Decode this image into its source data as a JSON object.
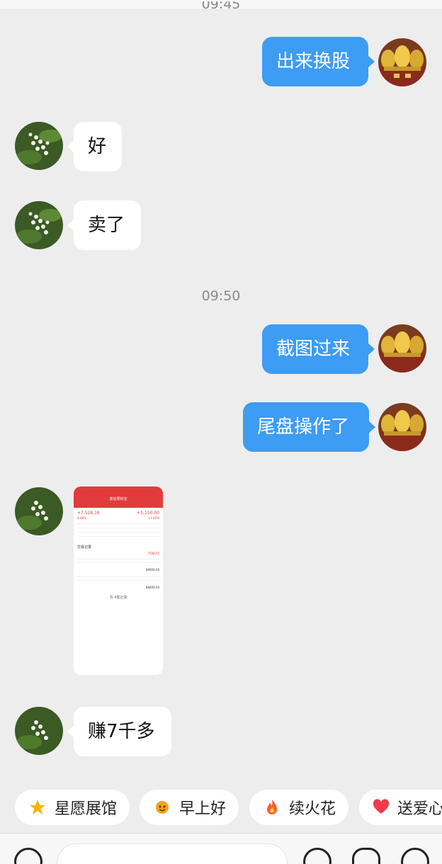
{
  "timestamps": [
    "09:45",
    "09:50"
  ],
  "messages": [
    {
      "side": "right",
      "text": "出来换股"
    },
    {
      "side": "left",
      "text": "好"
    },
    {
      "side": "left",
      "text": "卖了"
    },
    {
      "side": "right",
      "text": "截图过来"
    },
    {
      "side": "right",
      "text": "尾盘操作了"
    },
    {
      "side": "left",
      "type": "image"
    },
    {
      "side": "left",
      "text": "赚7千多"
    }
  ],
  "shared_screenshot": {
    "title": "鼎信周转宝",
    "values": [
      "+7,528.16",
      "+5,150.00",
      "0.08%",
      "+3.40%"
    ],
    "rows": [
      "7598.50",
      "89900.00",
      "88409.00"
    ],
    "section": "交易记录",
    "footer": "共 4笔记录"
  },
  "quick_chips": [
    {
      "label": "星愿展馆",
      "icon": "star-icon",
      "color": "#f5b400"
    },
    {
      "label": "早上好",
      "icon": "sun-face-icon",
      "color": "#f2a31a"
    },
    {
      "label": "续火花",
      "icon": "flame-icon",
      "color": "#ff5a2a"
    },
    {
      "label": "送爱心",
      "icon": "heart-icon",
      "color": "#ef3b4b"
    }
  ],
  "colors": {
    "bubble_right": "#3d9cf3",
    "bubble_left": "#ffffff",
    "background": "#ededed",
    "stock_red": "#e23b3b"
  }
}
